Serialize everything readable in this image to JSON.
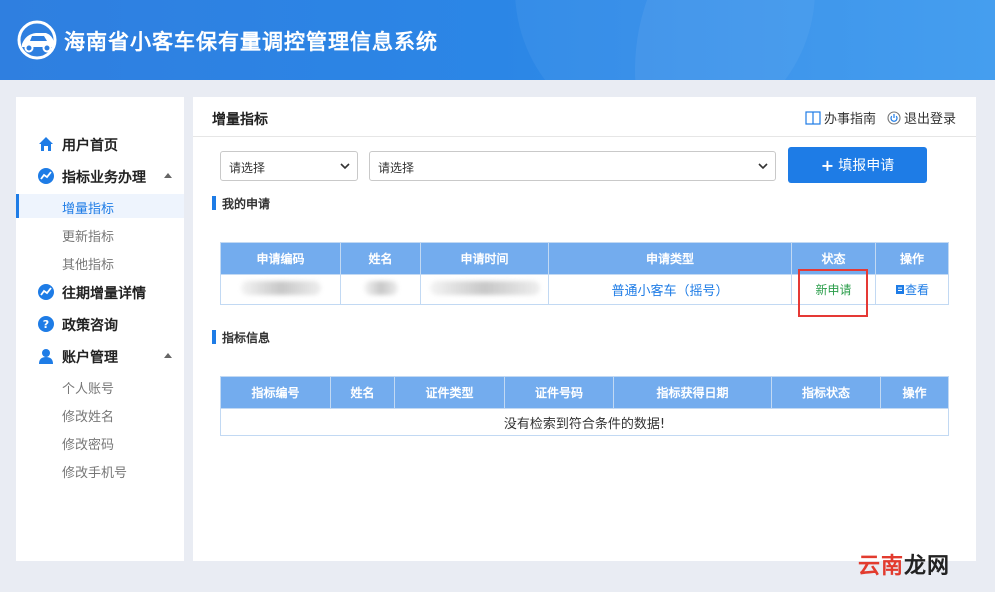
{
  "header": {
    "system_title": "海南省小客车保有量调控管理信息系统",
    "logo_icon": "car-logo-icon"
  },
  "sidebar": {
    "groups": [
      {
        "label": "用户首页",
        "icon": "home-icon"
      },
      {
        "label": "指标业务办理",
        "icon": "chart-icon",
        "expanded": true,
        "items": [
          {
            "label": "增量指标",
            "active": true
          },
          {
            "label": "更新指标"
          },
          {
            "label": "其他指标"
          }
        ]
      },
      {
        "label": "往期增量详情",
        "icon": "chart-icon"
      },
      {
        "label": "政策咨询",
        "icon": "question-icon"
      },
      {
        "label": "账户管理",
        "icon": "user-icon",
        "expanded": true,
        "items": [
          {
            "label": "个人账号"
          },
          {
            "label": "修改姓名"
          },
          {
            "label": "修改密码"
          },
          {
            "label": "修改手机号"
          }
        ]
      }
    ]
  },
  "main": {
    "title": "增量指标",
    "guide_label": "办事指南",
    "logout_label": "退出登录",
    "select1": "请选择",
    "select2": "请选择",
    "apply_plus": "+",
    "apply_label": "填报申请"
  },
  "my_applications": {
    "heading": "我的申请",
    "columns": [
      "申请编码",
      "姓名",
      "申请时间",
      "申请类型",
      "状态",
      "操作"
    ],
    "rows": [
      {
        "type": "普通小客车（摇号）",
        "status": "新申请",
        "action": "查看"
      }
    ]
  },
  "quota_info": {
    "heading": "指标信息",
    "columns": [
      "指标编号",
      "姓名",
      "证件类型",
      "证件号码",
      "指标获得日期",
      "指标状态",
      "操作"
    ],
    "empty_text": "没有检索到符合条件的数据!"
  },
  "watermark": {
    "part1": "云南",
    "part2": "龙网"
  },
  "colors": {
    "primary": "#1e7ce6",
    "header_th": "#73acee",
    "status_green": "#2a9d4a",
    "highlight_red": "#e53935"
  }
}
